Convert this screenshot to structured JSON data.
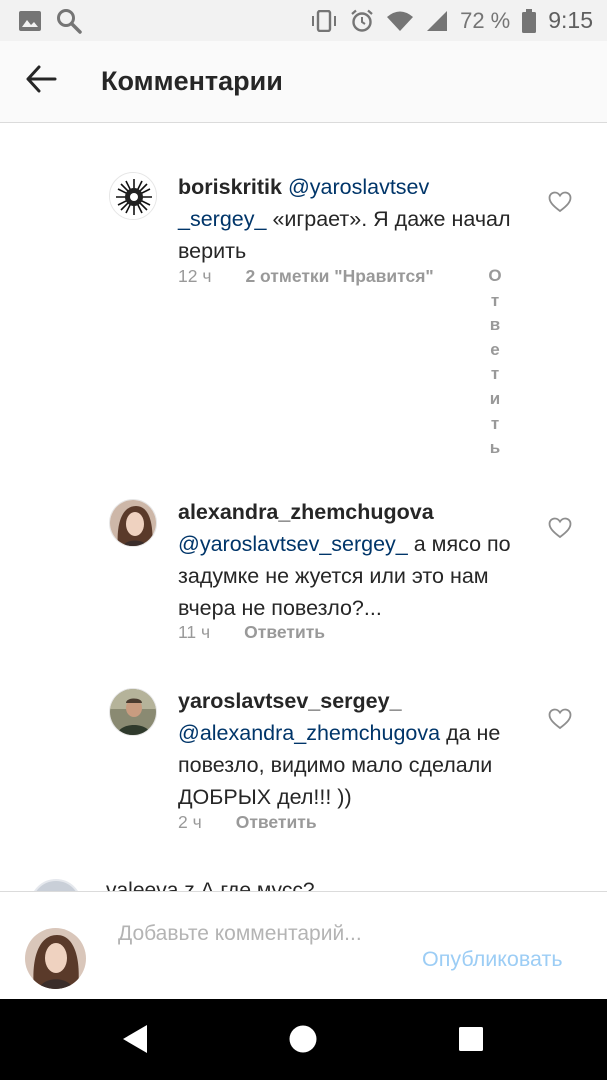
{
  "status_bar": {
    "battery_text": "72 %",
    "time": "9:15",
    "icons": [
      "image-icon",
      "search-icon",
      "vibrate-icon",
      "alarm-icon",
      "wifi-icon",
      "signal-icon",
      "battery-icon"
    ]
  },
  "header": {
    "title": "Комментарии",
    "back_icon": "arrow-left-icon"
  },
  "comments": [
    {
      "username": "boriskritik",
      "mention": "@yaroslavtsev_sergey_",
      "mention_line1": "@yaroslavtsev",
      "mention_line2": "_sergey_",
      "text": "«играет». Я даже начал верить",
      "time": "12 ч",
      "likes": "2 отметки \"Нравится\"",
      "reply": "Ответить"
    },
    {
      "username": "alexandra_zhemchugova",
      "mention": "@yaroslavtsev_sergey_",
      "text": "а мясо по задумке не жуется или это нам вчера не повезло?...",
      "time": "11 ч",
      "reply": "Ответить"
    },
    {
      "username": "yaroslavtsev_sergey_",
      "mention": "@alexandra_zhemchugova",
      "text": "да не повезло, видимо мало сделали ДОБРЫХ  дел!!! ))",
      "time": "2 ч",
      "reply": "Ответить"
    },
    {
      "partial_text": "valeeva.z А где мусс?"
    }
  ],
  "composer": {
    "placeholder": "Добавьте комментарий...",
    "post_label": "Опубликовать"
  },
  "nav": {
    "icons": [
      "back-triangle-icon",
      "home-circle-icon",
      "recents-square-icon"
    ]
  },
  "colors": {
    "mention": "#003569",
    "meta": "#999999",
    "post_button": "#9ccdf5"
  }
}
